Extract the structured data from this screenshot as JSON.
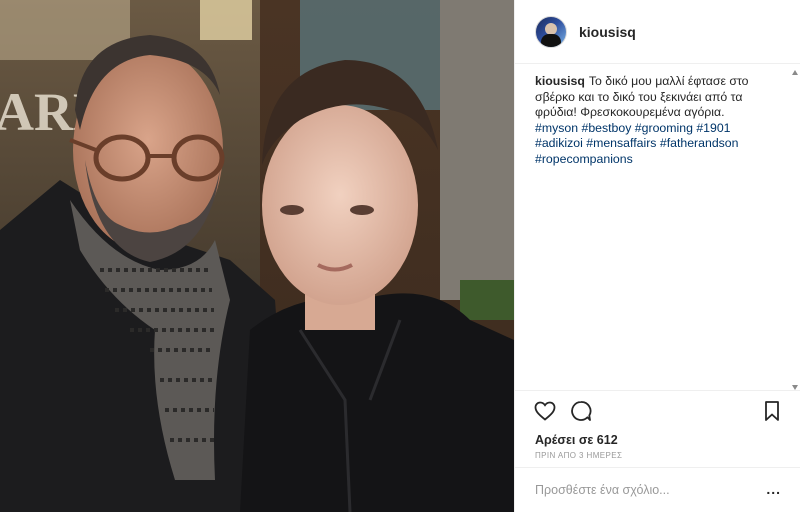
{
  "post": {
    "photo_description_icon": "photo-icon",
    "username": "kiousisq"
  },
  "caption": {
    "username": "kiousisq",
    "text": "Το δικό μου μαλλί έφτασε στο σβέρκο και το δικό του ξεκινάει από τα φρύδια! Φρεσκοκουρεμένα αγόρια.",
    "hashtags": "#myson #bestboy #grooming #1901 #adikizoi #mensaffairs #fatherandson #ropecompanions"
  },
  "actions": {
    "like_icon": "heart-icon",
    "comment_icon": "comment-icon",
    "save_icon": "bookmark-icon"
  },
  "likes": "Αρέσει σε 612",
  "timestamp": "ΠΡΙΝ ΑΠΟ 3 ΗΜΕΡΕΣ",
  "comment": {
    "placeholder": "Προσθέστε ένα σχόλιο...",
    "value": "",
    "more_label": "..."
  },
  "colors": {
    "hashtag": "#003569",
    "text": "#262626",
    "muted": "#999999",
    "border": "#efefef"
  }
}
